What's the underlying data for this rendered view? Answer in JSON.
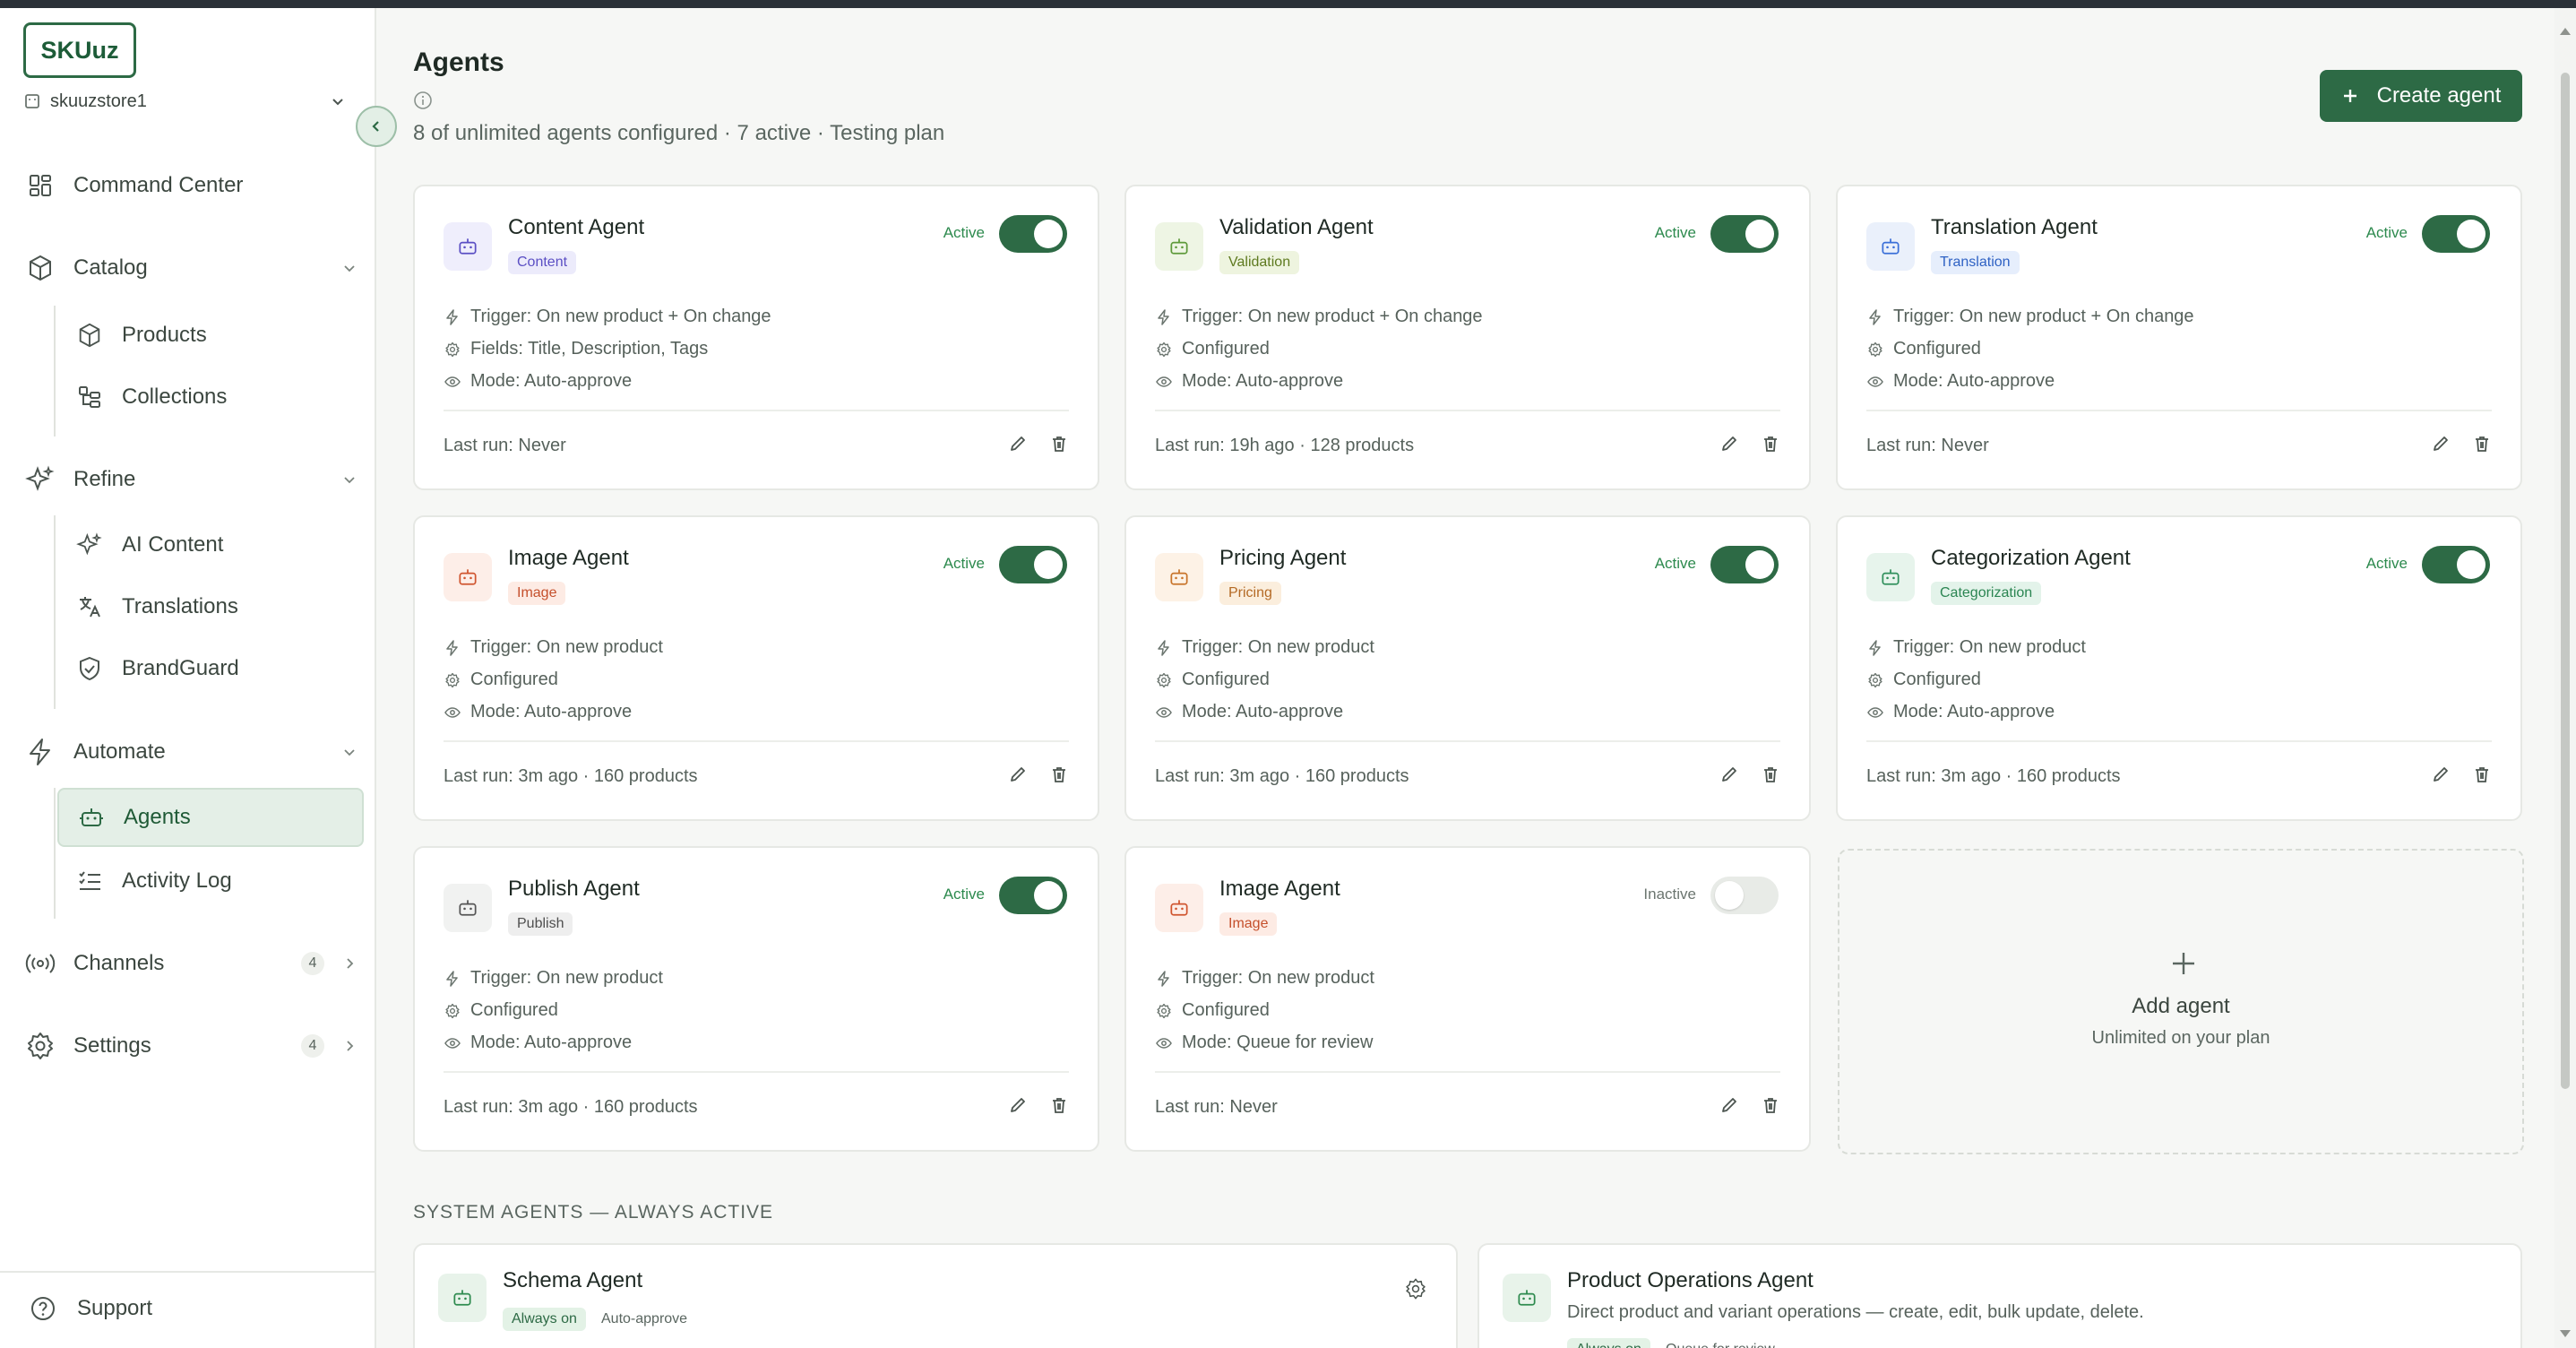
{
  "sidebar": {
    "logo": "SKUuz",
    "store": "skuuzstore1",
    "items": {
      "command_center": "Command Center",
      "catalog": "Catalog",
      "products": "Products",
      "collections": "Collections",
      "refine": "Refine",
      "ai_content": "AI Content",
      "translations": "Translations",
      "brandguard": "BrandGuard",
      "automate": "Automate",
      "agents": "Agents",
      "activity_log": "Activity Log",
      "channels": "Channels",
      "channels_count": "4",
      "settings": "Settings",
      "settings_count": "4"
    },
    "support": "Support"
  },
  "header": {
    "title": "Agents",
    "subtitle": "8 of unlimited agents configured · 7 active · Testing plan",
    "create_button": "Create agent"
  },
  "agents": [
    {
      "name": "Content Agent",
      "tag": "Content",
      "status": "Active",
      "trigger": "Trigger: On new product + On change",
      "config": "Fields: Title, Description, Tags",
      "mode": "Mode: Auto-approve",
      "last_run": "Last run: Never"
    },
    {
      "name": "Validation Agent",
      "tag": "Validation",
      "status": "Active",
      "trigger": "Trigger: On new product + On change",
      "config": "Configured",
      "mode": "Mode: Auto-approve",
      "last_run": "Last run: 19h ago · 128 products"
    },
    {
      "name": "Translation Agent",
      "tag": "Translation",
      "status": "Active",
      "trigger": "Trigger: On new product + On change",
      "config": "Configured",
      "mode": "Mode: Auto-approve",
      "last_run": "Last run: Never"
    },
    {
      "name": "Image Agent",
      "tag": "Image",
      "status": "Active",
      "trigger": "Trigger: On new product",
      "config": "Configured",
      "mode": "Mode: Auto-approve",
      "last_run": "Last run: 3m ago · 160 products"
    },
    {
      "name": "Pricing Agent",
      "tag": "Pricing",
      "status": "Active",
      "trigger": "Trigger: On new product",
      "config": "Configured",
      "mode": "Mode: Auto-approve",
      "last_run": "Last run: 3m ago · 160 products"
    },
    {
      "name": "Categorization Agent",
      "tag": "Categorization",
      "status": "Active",
      "trigger": "Trigger: On new product",
      "config": "Configured",
      "mode": "Mode: Auto-approve",
      "last_run": "Last run: 3m ago · 160 products"
    },
    {
      "name": "Publish Agent",
      "tag": "Publish",
      "status": "Active",
      "trigger": "Trigger: On new product",
      "config": "Configured",
      "mode": "Mode: Auto-approve",
      "last_run": "Last run: 3m ago · 160 products"
    },
    {
      "name": "Image Agent",
      "tag": "Image",
      "status": "Inactive",
      "trigger": "Trigger: On new product",
      "config": "Configured",
      "mode": "Mode: Queue for review",
      "last_run": "Last run: Never"
    }
  ],
  "add_agent": {
    "title": "Add agent",
    "subtitle": "Unlimited on your plan"
  },
  "system": {
    "section_title": "SYSTEM AGENTS — ALWAYS ACTIVE",
    "agents": [
      {
        "name": "Schema Agent",
        "always_on": "Always on",
        "mode": "Auto-approve",
        "description": ""
      },
      {
        "name": "Product Operations Agent",
        "always_on": "Always on",
        "mode": "Queue for review",
        "description": "Direct product and variant operations — create, edit, bulk update, delete."
      }
    ]
  },
  "colors": {
    "brand": "#2d6a45",
    "content_tag": "#6a5acd",
    "validation_tag": "#6b8e23",
    "translation_tag": "#3a6fd8",
    "image_tag": "#d0552f",
    "pricing_tag": "#c8742a",
    "categorization_tag": "#2f8f5b",
    "publish_tag": "#555555"
  }
}
